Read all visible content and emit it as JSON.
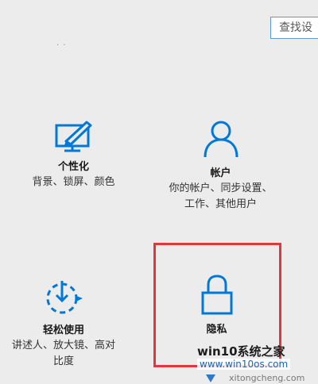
{
  "search": {
    "placeholder": "查找设"
  },
  "tiles": [
    {
      "title": "个性化",
      "desc": [
        "背景、锁屏、颜色"
      ],
      "icon": "personalization-icon"
    },
    {
      "title": "帐户",
      "desc": [
        "你的帐户、同步设置、",
        "工作、其他用户"
      ],
      "icon": "person-icon"
    },
    {
      "title": "轻松使用",
      "desc": [
        "讲述人、放大镜、高对",
        "比度"
      ],
      "icon": "ease-of-access-icon"
    },
    {
      "title": "隐私",
      "desc": [],
      "icon": "lock-icon"
    }
  ],
  "watermark": {
    "line1": "win10系统之家",
    "line2": "www.win10os.com",
    "line3": "xitongcheng.com"
  },
  "colors": {
    "accent": "#0078d7",
    "highlight": "#e0383e",
    "background": "#ececec"
  }
}
